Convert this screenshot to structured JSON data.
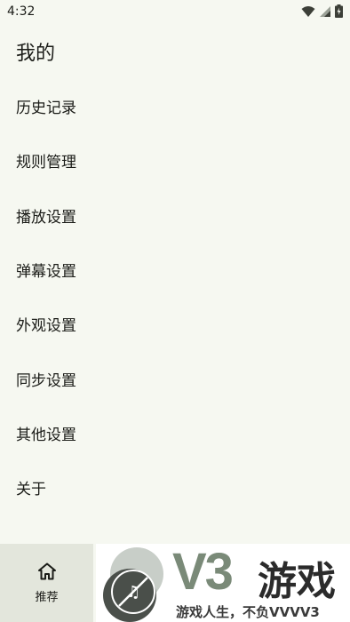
{
  "status_bar": {
    "time": "4:32"
  },
  "page": {
    "title": "我的"
  },
  "menu": {
    "items": [
      {
        "label": "历史记录"
      },
      {
        "label": "规则管理"
      },
      {
        "label": "播放设置"
      },
      {
        "label": "弹幕设置"
      },
      {
        "label": "外观设置"
      },
      {
        "label": "同步设置"
      },
      {
        "label": "其他设置"
      },
      {
        "label": "关于"
      }
    ]
  },
  "bottom_nav": {
    "tabs": [
      {
        "label": "推荐",
        "icon": "home-icon"
      }
    ]
  },
  "watermark": {
    "brand": "V3",
    "brand_text": "游戏",
    "slogan": "游戏人生，不负VVVV3"
  }
}
